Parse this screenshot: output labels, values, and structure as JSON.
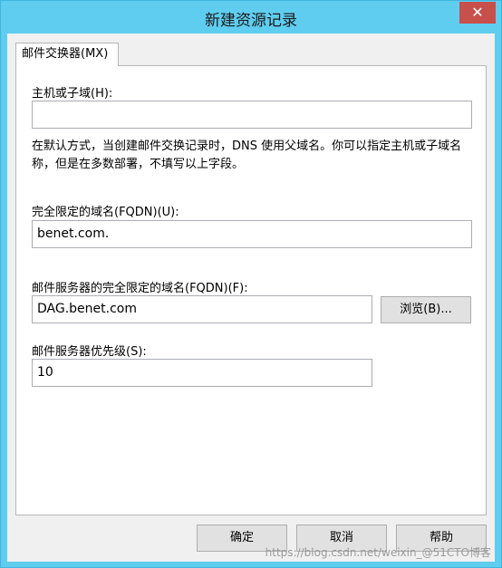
{
  "window": {
    "title": "新建资源记录",
    "close_glyph": "✕"
  },
  "tab": {
    "label": "邮件交换器(MX)"
  },
  "host": {
    "label": "主机或子域(H):",
    "value": "",
    "hint": "在默认方式，当创建邮件交换记录时，DNS 使用父域名。你可以指定主机或子域名称，但是在多数部署，不填写以上字段。"
  },
  "fqdn": {
    "label": "完全限定的域名(FQDN)(U):",
    "value": "benet.com."
  },
  "mail_server": {
    "label": "邮件服务器的完全限定的域名(FQDN)(F):",
    "value": "DAG.benet.com",
    "browse_label": "浏览(B)..."
  },
  "priority": {
    "label": "邮件服务器优先级(S):",
    "value": "10"
  },
  "buttons": {
    "ok": "确定",
    "cancel": "取消",
    "help": "帮助"
  },
  "watermark": "https://blog.csdn.net/weixin_@51CTO博客"
}
